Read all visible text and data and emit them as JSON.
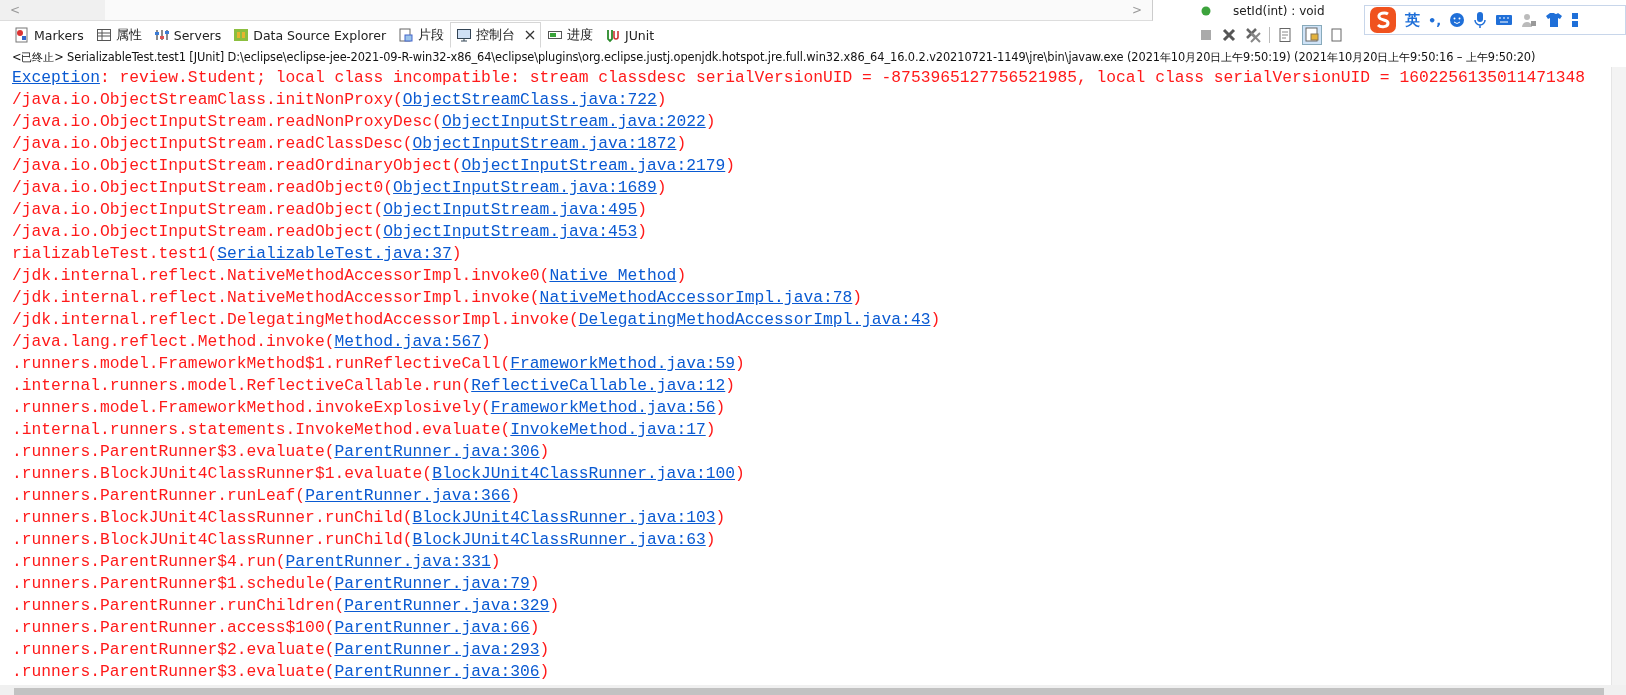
{
  "top_strip": {
    "scroll_arrow": "<",
    "right_scroll_arrow": ">",
    "outline_item": "setId(int) : void"
  },
  "tabs": [
    {
      "label": "Markers",
      "selected": false,
      "closable": false
    },
    {
      "label": "属性",
      "selected": false,
      "closable": false
    },
    {
      "label": "Servers",
      "selected": false,
      "closable": false
    },
    {
      "label": "Data Source Explorer",
      "selected": false,
      "closable": false
    },
    {
      "label": "片段",
      "selected": false,
      "closable": false
    },
    {
      "label": "控制台",
      "selected": true,
      "closable": true
    },
    {
      "label": "进度",
      "selected": false,
      "closable": false
    },
    {
      "label": "JUnit",
      "selected": false,
      "closable": false
    }
  ],
  "ime_bar": {
    "mode": "英",
    "punct": "•,"
  },
  "console": {
    "header": "<已终止> SerializableTest.test1 [JUnit] D:\\eclipse\\eclipse-jee-2021-09-R-win32-x86_64\\eclipse\\plugins\\org.eclipse.justj.openjdk.hotspot.jre.full.win32.x86_64_16.0.2.v20210721-1149\\jre\\bin\\javaw.exe  (2021年10月20日上午9:50:19)   (2021年10月20日上午9:50:16 – 上午9:50:20)",
    "lines": [
      {
        "kind": "exception",
        "link": "Exception",
        "text": ": review.Student; local class incompatible: stream classdesc serialVersionUID = -8753965127756521985, local class serialVersionUID = 1602256135011471348"
      },
      {
        "kind": "frame",
        "text": "/java.io.ObjectStreamClass.initNonProxy(",
        "link": "ObjectStreamClass.java:722",
        "tail": ")"
      },
      {
        "kind": "frame",
        "text": "/java.io.ObjectInputStream.readNonProxyDesc(",
        "link": "ObjectInputStream.java:2022",
        "tail": ")"
      },
      {
        "kind": "frame",
        "text": "/java.io.ObjectInputStream.readClassDesc(",
        "link": "ObjectInputStream.java:1872",
        "tail": ")"
      },
      {
        "kind": "frame",
        "text": "/java.io.ObjectInputStream.readOrdinaryObject(",
        "link": "ObjectInputStream.java:2179",
        "tail": ")"
      },
      {
        "kind": "frame",
        "text": "/java.io.ObjectInputStream.readObject0(",
        "link": "ObjectInputStream.java:1689",
        "tail": ")"
      },
      {
        "kind": "frame",
        "text": "/java.io.ObjectInputStream.readObject(",
        "link": "ObjectInputStream.java:495",
        "tail": ")"
      },
      {
        "kind": "frame",
        "text": "/java.io.ObjectInputStream.readObject(",
        "link": "ObjectInputStream.java:453",
        "tail": ")"
      },
      {
        "kind": "frame",
        "text": "rializableTest.test1(",
        "link": "SerializableTest.java:37",
        "tail": ")"
      },
      {
        "kind": "frame",
        "text": "/jdk.internal.reflect.NativeMethodAccessorImpl.invoke0(",
        "link": "Native Method",
        "tail": ")"
      },
      {
        "kind": "frame",
        "text": "/jdk.internal.reflect.NativeMethodAccessorImpl.invoke(",
        "link": "NativeMethodAccessorImpl.java:78",
        "tail": ")"
      },
      {
        "kind": "frame",
        "text": "/jdk.internal.reflect.DelegatingMethodAccessorImpl.invoke(",
        "link": "DelegatingMethodAccessorImpl.java:43",
        "tail": ")"
      },
      {
        "kind": "frame",
        "text": "/java.lang.reflect.Method.invoke(",
        "link": "Method.java:567",
        "tail": ")"
      },
      {
        "kind": "frame",
        "text": ".runners.model.FrameworkMethod$1.runReflectiveCall(",
        "link": "FrameworkMethod.java:59",
        "tail": ")"
      },
      {
        "kind": "frame",
        "text": ".internal.runners.model.ReflectiveCallable.run(",
        "link": "ReflectiveCallable.java:12",
        "tail": ")"
      },
      {
        "kind": "frame",
        "text": ".runners.model.FrameworkMethod.invokeExplosively(",
        "link": "FrameworkMethod.java:56",
        "tail": ")"
      },
      {
        "kind": "frame",
        "text": ".internal.runners.statements.InvokeMethod.evaluate(",
        "link": "InvokeMethod.java:17",
        "tail": ")"
      },
      {
        "kind": "frame",
        "text": ".runners.ParentRunner$3.evaluate(",
        "link": "ParentRunner.java:306",
        "tail": ")"
      },
      {
        "kind": "frame",
        "text": ".runners.BlockJUnit4ClassRunner$1.evaluate(",
        "link": "BlockJUnit4ClassRunner.java:100",
        "tail": ")"
      },
      {
        "kind": "frame",
        "text": ".runners.ParentRunner.runLeaf(",
        "link": "ParentRunner.java:366",
        "tail": ")"
      },
      {
        "kind": "frame",
        "text": ".runners.BlockJUnit4ClassRunner.runChild(",
        "link": "BlockJUnit4ClassRunner.java:103",
        "tail": ")"
      },
      {
        "kind": "frame",
        "text": ".runners.BlockJUnit4ClassRunner.runChild(",
        "link": "BlockJUnit4ClassRunner.java:63",
        "tail": ")"
      },
      {
        "kind": "frame",
        "text": ".runners.ParentRunner$4.run(",
        "link": "ParentRunner.java:331",
        "tail": ")"
      },
      {
        "kind": "frame",
        "text": ".runners.ParentRunner$1.schedule(",
        "link": "ParentRunner.java:79",
        "tail": ")"
      },
      {
        "kind": "frame",
        "text": ".runners.ParentRunner.runChildren(",
        "link": "ParentRunner.java:329",
        "tail": ")"
      },
      {
        "kind": "frame",
        "text": ".runners.ParentRunner.access$100(",
        "link": "ParentRunner.java:66",
        "tail": ")"
      },
      {
        "kind": "frame",
        "text": ".runners.ParentRunner$2.evaluate(",
        "link": "ParentRunner.java:293",
        "tail": ")"
      },
      {
        "kind": "frame",
        "text": ".runners.ParentRunner$3.evaluate(",
        "link": "ParentRunner.java:306",
        "tail": ")"
      }
    ]
  }
}
